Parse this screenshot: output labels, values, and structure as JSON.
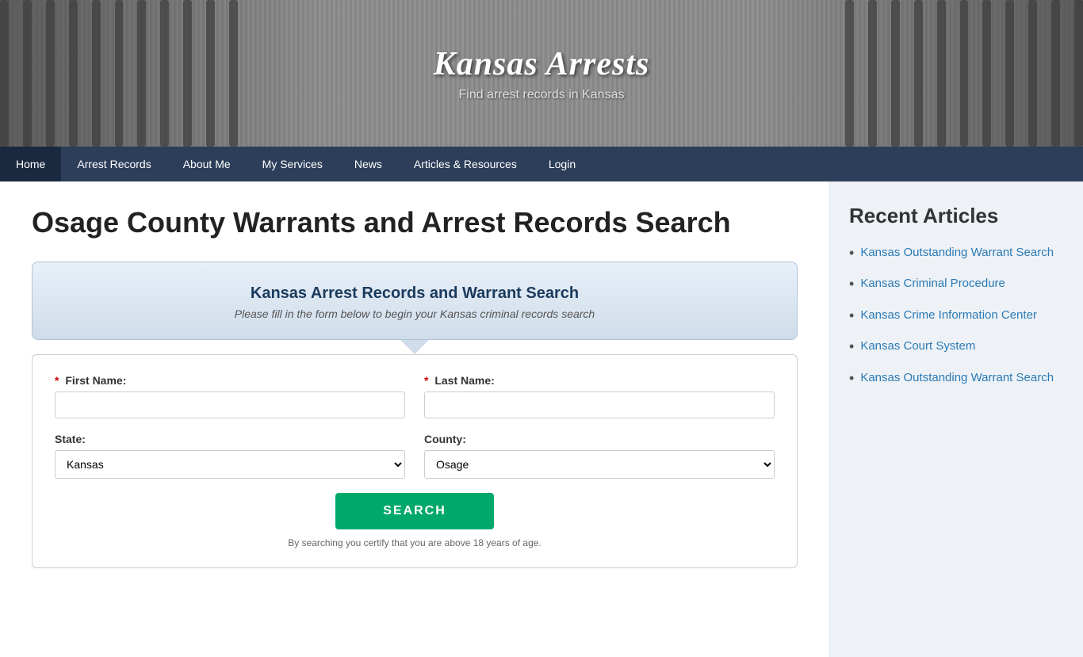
{
  "hero": {
    "title": "Kansas Arrests",
    "subtitle": "Find arrest records in Kansas"
  },
  "nav": {
    "items": [
      {
        "label": "Home",
        "active": true
      },
      {
        "label": "Arrest Records"
      },
      {
        "label": "About Me"
      },
      {
        "label": "My Services"
      },
      {
        "label": "News"
      },
      {
        "label": "Articles & Resources"
      },
      {
        "label": "Login"
      }
    ]
  },
  "main": {
    "page_heading": "Osage County Warrants and Arrest Records Search",
    "card_title": "Kansas Arrest Records and Warrant Search",
    "card_subtitle": "Please fill in the form below to begin your Kansas criminal records search",
    "form": {
      "first_name_label": "First Name:",
      "last_name_label": "Last Name:",
      "state_label": "State:",
      "county_label": "County:",
      "state_default": "Kansas",
      "county_default": "Osage",
      "search_button": "SEARCH",
      "disclaimer": "By searching you certify that you are above 18 years of age."
    }
  },
  "sidebar": {
    "title": "Recent Articles",
    "articles": [
      {
        "label": "Kansas Outstanding Warrant Search"
      },
      {
        "label": "Kansas Criminal Procedure"
      },
      {
        "label": "Kansas Crime Information Center"
      },
      {
        "label": "Kansas Court System"
      },
      {
        "label": "Kansas Outstanding Warrant Search"
      }
    ]
  }
}
